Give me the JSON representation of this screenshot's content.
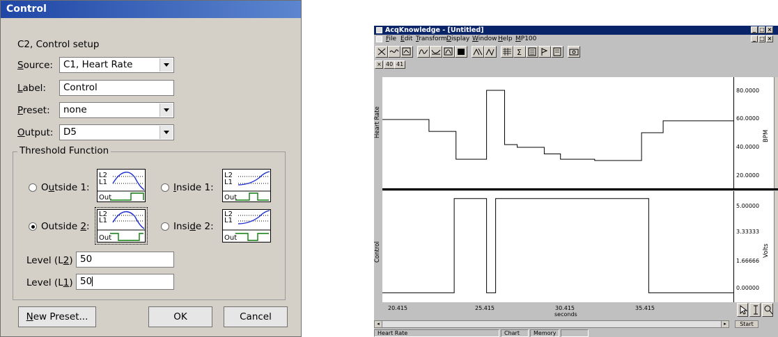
{
  "dialog": {
    "title": "Control",
    "subtitle": "C2, Control setup",
    "source": {
      "label": "Source:",
      "hotkey": "S",
      "rest": "ource:",
      "value": "C1, Heart Rate"
    },
    "label": {
      "label": "Label:",
      "hotkey": "L",
      "rest": "abel:",
      "value": "Control"
    },
    "preset": {
      "label": "Preset:",
      "hotkey": "P",
      "rest": "reset:",
      "value": "none"
    },
    "output": {
      "label": "Output:",
      "hotkey": "O",
      "rest": "utput:",
      "value": "D5"
    },
    "threshold_group": "Threshold Function",
    "options": [
      {
        "pre": "O",
        "hotkey": "u",
        "post": "tside 1:",
        "selected": false
      },
      {
        "pre": "",
        "hotkey": "I",
        "post": "nside 1:",
        "selected": false
      },
      {
        "pre": "Outside ",
        "hotkey": "2",
        "post": ":",
        "selected": true
      },
      {
        "pre": "Insi",
        "hotkey": "d",
        "post": "e 2:",
        "selected": false
      }
    ],
    "thumb_labels": {
      "l2": "L2",
      "l1": "L1",
      "out": "Out"
    },
    "level_l2": {
      "pre": "Level (L",
      "hotkey": "2",
      "post": ")",
      "value": "50"
    },
    "level_l1": {
      "pre": "Level (L",
      "hotkey": "1",
      "post": ")",
      "value": "50"
    },
    "buttons": {
      "new_preset_hotkey": "N",
      "new_preset_rest": "ew Preset...",
      "ok": "OK",
      "cancel": "Cancel"
    }
  },
  "acq": {
    "title": "AcqKnowledge - [Untitled]",
    "menu": [
      {
        "hotkey": "F",
        "rest": "ile"
      },
      {
        "hotkey": "E",
        "rest": "dit"
      },
      {
        "hotkey": "T",
        "rest": "ransform"
      },
      {
        "hotkey": "D",
        "rest": "isplay"
      },
      {
        "hotkey": "W",
        "rest": "indow"
      },
      {
        "hotkey": "H",
        "rest": "elp"
      },
      {
        "hotkey": "M",
        "rest": "P100"
      }
    ],
    "channel_buttons": [
      "40",
      "41"
    ],
    "ch1_name": "Heart Rate",
    "ch1_unit": "BPM",
    "ch1_ticks": [
      "80.0000",
      "60.0000",
      "40.0000",
      "20.0000"
    ],
    "ch2_name": "Control",
    "ch2_unit": "Volts",
    "ch2_ticks": [
      "5.00000",
      "3.33333",
      "1.66666",
      "0.00000"
    ],
    "x_ticks": [
      "20.415",
      "25.415",
      "30.415",
      "35.415"
    ],
    "x_unit": "seconds",
    "start_label": "Start",
    "status": [
      "Heart Rate",
      "Chart",
      "Memory"
    ]
  },
  "chart_data": [
    {
      "type": "line",
      "ylabel": "Heart Rate",
      "yunit": "BPM",
      "xlabel": "seconds",
      "xlim": [
        20.415,
        39.9
      ],
      "ylim": [
        8,
        92
      ],
      "series": [
        {
          "name": "Heart Rate",
          "x": [
            20.415,
            23.0,
            23.0,
            24.5,
            24.5,
            26.2,
            26.2,
            27.2,
            27.2,
            27.9,
            27.9,
            29.4,
            29.4,
            30.3,
            30.3,
            32.2,
            32.2,
            34.8,
            34.8,
            36.0,
            36.0,
            39.9
          ],
          "y": [
            60.0,
            60.0,
            51.0,
            51.0,
            30.0,
            30.0,
            82.0,
            82.0,
            41.0,
            41.0,
            39.0,
            39.0,
            34.0,
            34.0,
            30.0,
            30.0,
            29.0,
            29.0,
            50.0,
            50.0,
            59.0,
            59.0
          ]
        }
      ]
    },
    {
      "type": "line",
      "ylabel": "Control",
      "yunit": "Volts",
      "xlabel": "seconds",
      "xlim": [
        20.415,
        39.9
      ],
      "ylim": [
        -0.5,
        5.4
      ],
      "series": [
        {
          "name": "Control",
          "x": [
            20.415,
            24.4,
            24.4,
            26.2,
            26.2,
            26.7,
            26.7,
            28.0,
            28.0,
            35.2,
            35.2,
            39.9
          ],
          "y": [
            0.0,
            0.0,
            5.0,
            5.0,
            0.0,
            0.0,
            5.0,
            5.0,
            5.0,
            5.0,
            0.0,
            0.0
          ]
        }
      ]
    }
  ]
}
